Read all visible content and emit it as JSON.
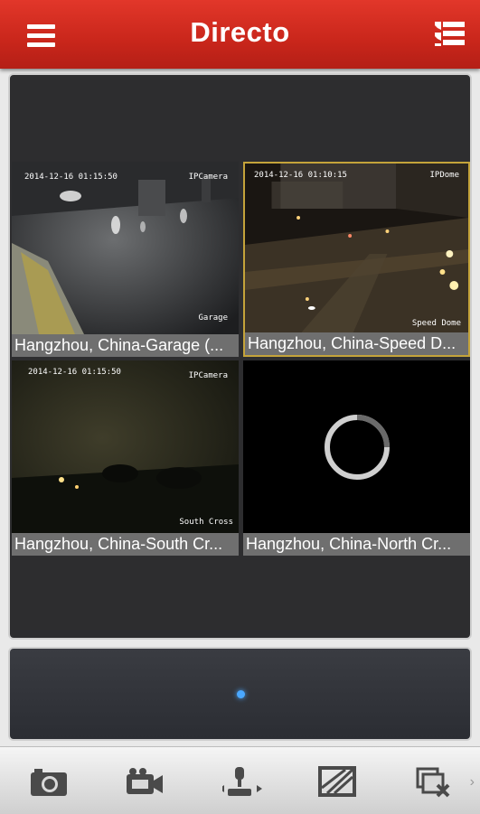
{
  "header": {
    "title": "Directo",
    "menu_icon": "hamburger-menu-icon",
    "list_icon": "device-list-icon",
    "bg_color": "#c9261b"
  },
  "cameras": [
    {
      "caption": "Hangzhou, China-Garage (...",
      "osd_time": "2014-12-16 01:15:50",
      "osd_type": "IPCamera",
      "osd_name": "Garage",
      "selected": false
    },
    {
      "caption": "Hangzhou, China-Speed D...",
      "osd_time": "2014-12-16 01:10:15",
      "osd_type": "IPDome",
      "osd_name": "Speed Dome",
      "selected": true
    },
    {
      "caption": "Hangzhou, China-South Cr...",
      "osd_time": "2014-12-16 01:15:50",
      "osd_type": "IPCamera",
      "osd_name": "South Cross",
      "selected": false
    },
    {
      "caption": "Hangzhou, China-North Cr...",
      "status": "loading",
      "selected": false
    }
  ],
  "pager": {
    "current_page": 1,
    "total_pages": 1
  },
  "toolbar": {
    "items": [
      "camera-capture-icon",
      "video-record-icon",
      "ptz-control-icon",
      "image-quality-icon",
      "close-window-icon"
    ],
    "more_arrow": "›"
  }
}
